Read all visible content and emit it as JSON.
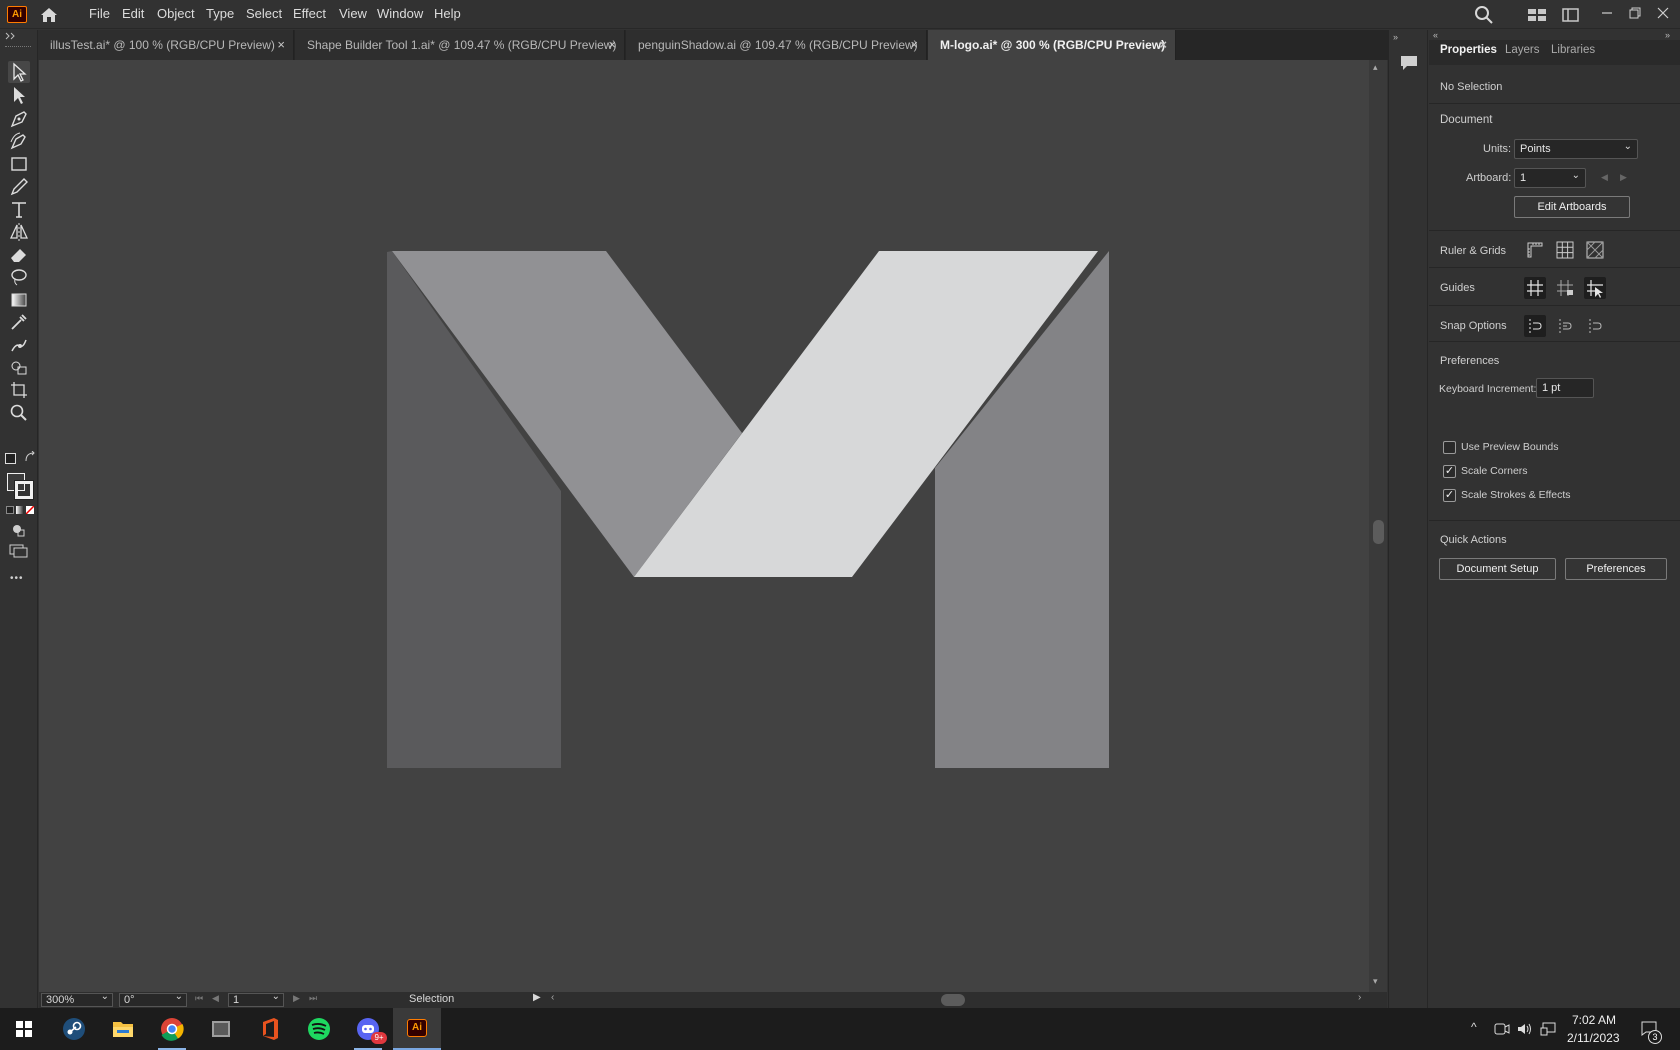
{
  "app": {
    "badge": "Ai",
    "menu": [
      "File",
      "Edit",
      "Object",
      "Type",
      "Select",
      "Effect",
      "View",
      "Window",
      "Help"
    ]
  },
  "tabs": [
    {
      "label": "illusTest.ai* @ 100 % (RGB/CPU Preview)",
      "close": "×",
      "active": false
    },
    {
      "label": "Shape Builder Tool 1.ai* @ 109.47 % (RGB/CPU Preview)",
      "close": "×",
      "active": false
    },
    {
      "label": "penguinShadow.ai @ 109.47 % (RGB/CPU Preview)",
      "close": "×",
      "active": false
    },
    {
      "label": "M-logo.ai* @ 300 % (RGB/CPU Preview)",
      "close": "×",
      "active": true
    }
  ],
  "toolbar": {
    "tools": [
      "selection-tool",
      "direct-selection-tool",
      "pen-tool",
      "curvature-tool",
      "rectangle-tool",
      "pencil-tool",
      "type-tool",
      "reflect-tool",
      "eraser-tool",
      "lasso-tool",
      "gradient-tool",
      "eyedropper-tool",
      "puppet-warp-tool",
      "shape-builder-tool",
      "artboard-tool",
      "zoom-tool"
    ],
    "more": "•••"
  },
  "properties": {
    "tabs": [
      "Properties",
      "Layers",
      "Libraries"
    ],
    "selection": "No Selection",
    "document": {
      "heading": "Document",
      "units_label": "Units:",
      "units_value": "Points",
      "artboard_label": "Artboard:",
      "artboard_value": "1",
      "edit_artboards": "Edit Artboards"
    },
    "ruler_grids": "Ruler & Grids",
    "guides": "Guides",
    "snap_options": "Snap Options",
    "preferences": {
      "heading": "Preferences",
      "keyboard_increment_label": "Keyboard Increment:",
      "keyboard_increment_value": "1 pt",
      "use_preview_bounds": "Use Preview Bounds",
      "use_preview_bounds_checked": false,
      "scale_corners": "Scale Corners",
      "scale_corners_checked": true,
      "scale_strokes": "Scale Strokes & Effects",
      "scale_strokes_checked": true
    },
    "quick_actions": {
      "heading": "Quick Actions",
      "document_setup": "Document Setup",
      "preferences": "Preferences"
    }
  },
  "status": {
    "zoom": "300%",
    "rotation": "0°",
    "artboard": "1",
    "tool": "Selection"
  },
  "taskbar": {
    "apps": [
      "start",
      "steam",
      "file-explorer",
      "chrome",
      "app-window",
      "office",
      "spotify",
      "discord",
      "illustrator"
    ],
    "discord_badge": "9+",
    "ai_badge": "Ai",
    "time": "7:02 AM",
    "date": "2/11/2023",
    "notifications": "3"
  },
  "colors": {
    "canvas": "#424242",
    "logo_dark": "#5a5a5c",
    "logo_mid": "#919194",
    "logo_light": "#d7d8d9",
    "logo_right": "#838386",
    "accent": "#ff9a00"
  }
}
